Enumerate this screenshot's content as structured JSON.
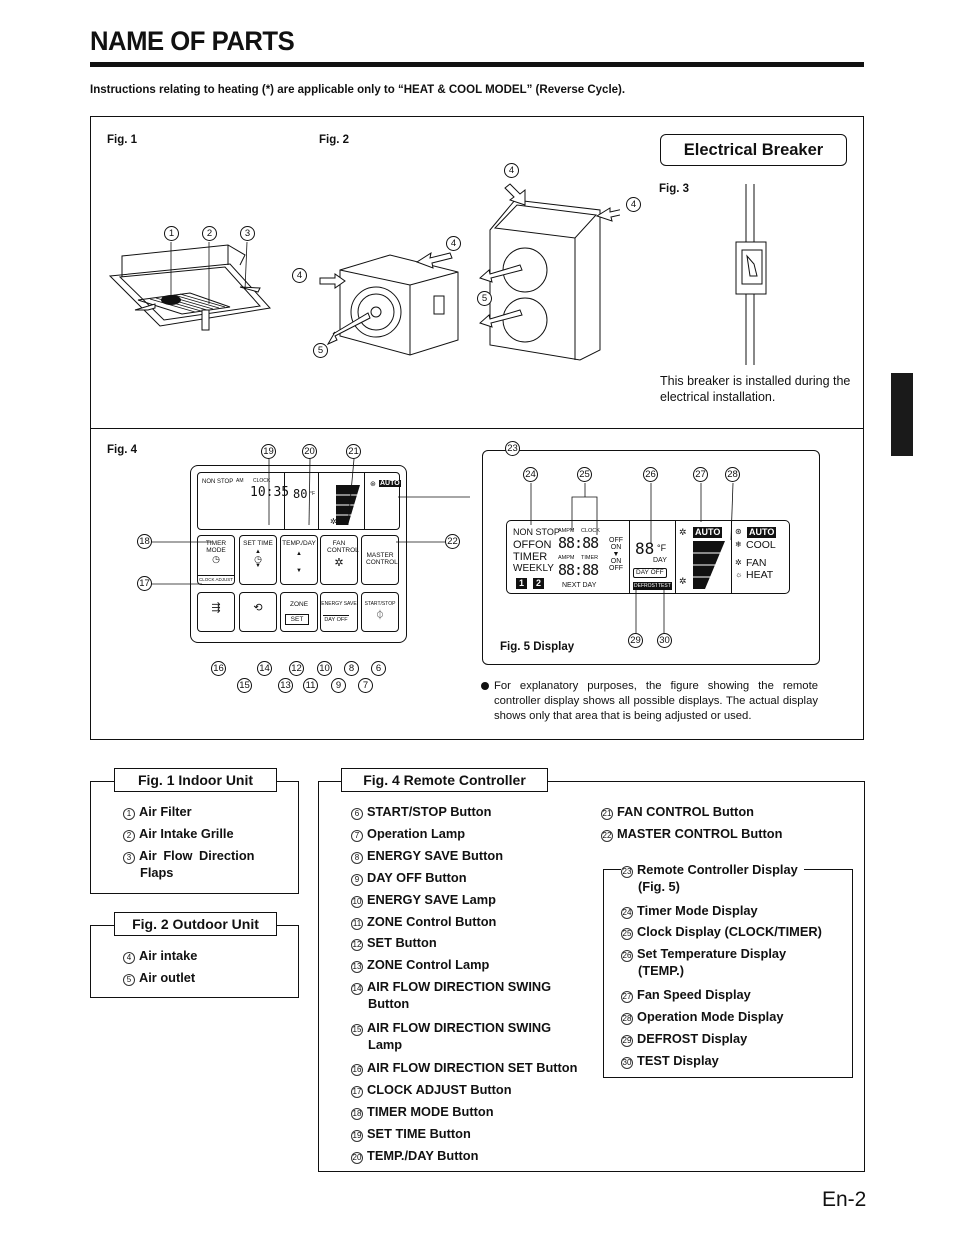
{
  "header": {
    "title": "NAME OF PARTS",
    "note": "Instructions relating to heating (*) are applicable only to “HEAT & COOL MODEL” (Reverse Cycle)."
  },
  "figures": {
    "fig1_label": "Fig. 1",
    "fig2_label": "Fig. 2",
    "fig3_label": "Fig. 3",
    "fig4_label": "Fig. 4",
    "fig5_label": "Fig. 5 Display",
    "electrical_breaker_title": "Electrical Breaker",
    "breaker_note": "This breaker is installed during the electrical installation.",
    "display_note": "For explanatory purposes, the figure showing the remote controller display shows all possible displays. The actual display shows only that area that is being adjusted or used.",
    "fig1_callouts": [
      "1",
      "2",
      "3"
    ],
    "fig2_callouts": [
      "4",
      "4",
      "5",
      "4",
      "4",
      "5"
    ],
    "remote": {
      "lcd": {
        "nonstop": "NON STOP",
        "am": "AM",
        "clock": "CLOCK",
        "time": "10:35",
        "temp": "80",
        "temp_unit": "°F",
        "auto": "AUTO"
      },
      "buttons": {
        "timer_mode": "TIMER MODE",
        "clock_adjust": "CLOCK ADJUST",
        "set_time": "SET TIME",
        "temp_day": "TEMP./DAY",
        "fan_control": "FAN CONTROL",
        "master_control": "MASTER CONTROL",
        "zone": "ZONE",
        "set": "SET",
        "energy_save": "ENERGY SAVE",
        "day_off": "DAY OFF",
        "start_stop": "START/STOP"
      },
      "callouts_top": [
        "19",
        "20",
        "21"
      ],
      "callouts_left": [
        "18",
        "17"
      ],
      "callouts_right": [
        "22"
      ],
      "callouts_bottom_row1": [
        "16",
        "14",
        "12",
        "10",
        "8",
        "6"
      ],
      "callouts_bottom_row2": [
        "15",
        "13",
        "11",
        "9",
        "7"
      ]
    },
    "display": {
      "callout_main": "23",
      "callouts_top": [
        "24",
        "25",
        "26",
        "27",
        "28"
      ],
      "callouts_bottom": [
        "29",
        "30"
      ],
      "nonstop": "NON STOP",
      "offon": "OFFON",
      "timer": "TIMER",
      "weekly": "WEEKLY",
      "day1": "1",
      "day2": "2",
      "ampm1": "AMPM",
      "clock": "CLOCK",
      "ampm2": "AMPM",
      "timer_lbl": "TIMER",
      "digits1": "88:88",
      "digits2": "88:88",
      "off1": "OFF",
      "on1": "ON",
      "on2": "ON",
      "off2": "OFF",
      "next_day": "NEXT DAY",
      "temp_digits": "88",
      "temp_unit": "°F",
      "day": "DAY",
      "day_off": "DAY OFF",
      "defrost": "DEFROST",
      "test": "TEST",
      "fan_auto": "AUTO",
      "mode_auto": "AUTO",
      "cool": "COOL",
      "fan": "FAN",
      "heat": "HEAT"
    }
  },
  "legends": {
    "indoor": {
      "title": "Fig. 1  Indoor Unit",
      "items": [
        {
          "num": "1",
          "label": "Air Filter"
        },
        {
          "num": "2",
          "label": "Air Intake Grille"
        },
        {
          "num": "3",
          "label": "Air  Flow  Direction",
          "cont": "Flaps"
        }
      ]
    },
    "outdoor": {
      "title": "Fig. 2  Outdoor Unit",
      "items": [
        {
          "num": "4",
          "label": "Air intake"
        },
        {
          "num": "5",
          "label": "Air outlet"
        }
      ]
    },
    "remote": {
      "title": "Fig. 4  Remote Controller",
      "col1": [
        {
          "num": "6",
          "label": "START/STOP Button"
        },
        {
          "num": "7",
          "label": "Operation Lamp"
        },
        {
          "num": "8",
          "label": "ENERGY SAVE Button"
        },
        {
          "num": "9",
          "label": "DAY OFF Button"
        },
        {
          "num": "10",
          "label": "ENERGY SAVE Lamp"
        },
        {
          "num": "11",
          "label": "ZONE Control Button"
        },
        {
          "num": "12",
          "label": "SET Button"
        },
        {
          "num": "13",
          "label": "ZONE Control Lamp"
        },
        {
          "num": "14",
          "label": "AIR FLOW DIRECTION SWING",
          "cont": "Button"
        },
        {
          "num": "15",
          "label": "AIR FLOW DIRECTION SWING",
          "cont": "Lamp"
        },
        {
          "num": "16",
          "label": "AIR FLOW DIRECTION SET Button"
        },
        {
          "num": "17",
          "label": "CLOCK ADJUST Button"
        },
        {
          "num": "18",
          "label": "TIMER MODE Button"
        },
        {
          "num": "19",
          "label": "SET TIME Button"
        },
        {
          "num": "20",
          "label": "TEMP./DAY Button"
        }
      ],
      "col2": [
        {
          "num": "21",
          "label": "FAN CONTROL Button"
        },
        {
          "num": "22",
          "label": "MASTER CONTROL Button"
        }
      ],
      "display_sub": [
        {
          "num": "23",
          "label": "Remote Controller Display",
          "cont": "(Fig. 5)"
        },
        {
          "num": "24",
          "label": "Timer Mode Display"
        },
        {
          "num": "25",
          "label": "Clock Display (CLOCK/TIMER)"
        },
        {
          "num": "26",
          "label": "Set  Temperature  Display",
          "cont": "(TEMP.)"
        },
        {
          "num": "27",
          "label": "Fan Speed Display"
        },
        {
          "num": "28",
          "label": "Operation Mode Display"
        },
        {
          "num": "29",
          "label": "DEFROST Display"
        },
        {
          "num": "30",
          "label": "TEST Display"
        }
      ]
    }
  },
  "footer": {
    "page": "En-2"
  }
}
